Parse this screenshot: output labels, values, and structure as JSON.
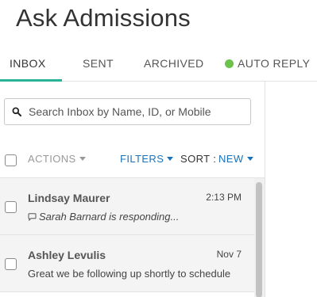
{
  "header": {
    "title": "Ask Admissions"
  },
  "tabs": [
    {
      "label": "INBOX"
    },
    {
      "label": "SENT"
    },
    {
      "label": "ARCHIVED"
    },
    {
      "label": "AUTO REPLY"
    }
  ],
  "search": {
    "placeholder": "Search Inbox by Name, ID, or Mobile",
    "value": ""
  },
  "toolbar": {
    "actions_label": "ACTIONS",
    "filters_label": "FILTERS",
    "sort_label": "SORT :",
    "sort_value": "NEW"
  },
  "messages": [
    {
      "name": "Lindsay Maurer",
      "time": "2:13 PM",
      "preview": "Sarah Barnard is responding..."
    },
    {
      "name": "Ashley Levulis",
      "time": "Nov 7",
      "preview": "Great we be following up shortly to schedule"
    }
  ],
  "colors": {
    "accent": "#2bb39a",
    "link": "#1a73ba",
    "status_green": "#6cc24a"
  },
  "icons": [
    "search-icon",
    "chat-bubble-icon",
    "status-dot-icon",
    "caret-down-icon"
  ]
}
